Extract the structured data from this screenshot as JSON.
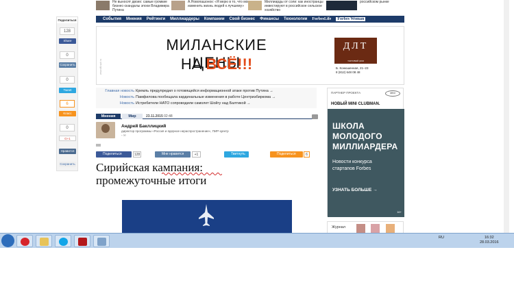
{
  "share_column": {
    "header": "Поделиться",
    "counts": [
      "128",
      "0",
      "0",
      "0",
      "6",
      "0"
    ],
    "buttons": [
      "Share",
      "Сохранить",
      "Tweet",
      "Класс",
      "G+1",
      "Нравится",
      "Сохранить"
    ]
  },
  "top_news": [
    "Не выносят двоих: самые громкие бизнес-скандалы эпохи Владимира Путина",
    "А.Новопашонок: «Я верю в то, что могу изменить жизнь людей к лучшему»",
    "Миллиарды от соли: как иностранцы инвестируют в российское сельское хозяйство",
    "российском рынке"
  ],
  "nav": [
    "События",
    "Мнения",
    "Рейтинги",
    "Миллиардеры",
    "Компании",
    "Свой бизнес",
    "Финансы",
    "Технологии",
    "ForbesLife",
    "Forbes Woman"
  ],
  "banner": {
    "vertical_text": "www.dlt-spb.ru",
    "line1": "МИЛАНСКИЕ ЦЕНЫ",
    "line2_prefix": "НА",
    "line2_accent": "ВСЁ!!!",
    "logo": "ДЛТ",
    "logo_sub": "ТОРГОВЫЙ ДОМ",
    "address": "Б. Конюшенная, 21–23",
    "phone": "8 (812) 648 08 48"
  },
  "headlines": [
    {
      "tag": "Главная новость",
      "text": "Кремль предупредил о готовящейся информационной атаке против Путина →"
    },
    {
      "tag": "Новость",
      "text": "Памфилова пообещала кардинальные изменения в работе Центризбиркома →"
    },
    {
      "tag": "Новость",
      "text": "Истребители НАТО сопроводили самолет Шойгу над Балтикой →"
    }
  ],
  "article": {
    "tab_active": "Мнения",
    "tab_second": "Мир",
    "date": "23.11.2015",
    "time": "02:48",
    "author": "Андрей Бакллицкий",
    "author_desc": "директор программы «Россия и ядерное нераспространение», ПИР-Центр",
    "share_fb": "Поделиться",
    "share_fb_count": "128",
    "share_vk": "Мне нравится",
    "share_vk_count": "+1",
    "share_tw": "Твитнуть",
    "share_ok": "Поделиться",
    "share_ok_count": "6",
    "title_line1": "Сирийская кампания:",
    "title_line2": "промежуточные итоги"
  },
  "partner": {
    "label": "ПАРТНЕР ПРОЕКТА",
    "brand": "MINI",
    "headline": "НОВЫЙ MINI CLUBMAN.",
    "big_lines": [
      "ШКОЛА",
      "МОЛОДОГО",
      "МИЛЛИАРДЕРА"
    ],
    "sub_lines": [
      "Новости конкурса",
      "стартапов Forbes"
    ],
    "more": "УЗНАТЬ БОЛЬШЕ →",
    "age": "16+"
  },
  "journal": {
    "label": "Журнал"
  },
  "taskbar": {
    "lang": "RU",
    "time": "16:32",
    "date": "28.03.2016"
  },
  "colors": {
    "nav_bg": "#1d3b69",
    "accent_orange": "#e24a18",
    "partner_bg": "#3f5860",
    "taskbar": "#bcd3ec"
  }
}
